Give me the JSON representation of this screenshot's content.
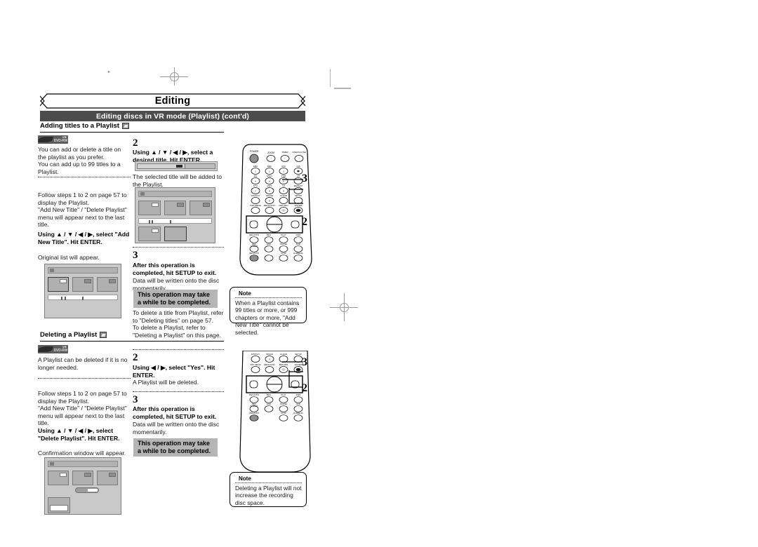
{
  "page": {
    "banner_title": "Editing",
    "sub_banner": "Editing discs in VR mode (Playlist) (cont'd)"
  },
  "section_add": {
    "heading": "Adding titles to a Playlist",
    "badge_icon": "dvd-rw-disc-icon",
    "vr_logo": {
      "top": "VR",
      "bottom": "DVD-RW"
    },
    "intro": "You can add or delete a title on the playlist as you prefer.\nYou can add up to 99 titles to a Playlist.",
    "step1_body": "Follow steps 1 to 2 on page 57 to display the Playlist.\n\"Add New Title\" / \"Delete Playlist\" menu will appear next to the last title.",
    "step1_bold": "Using ▲ / ▼ / ◀ / ▶, select \"Add New Title\". Hit ENTER.",
    "step1_after": "Original list will appear.",
    "step2_num": "2",
    "step2_bold": "Using ▲ / ▼ / ◀ / ▶, select a desired title. Hit ENTER.",
    "step2_after": "The selected title will be added to the Playlist.",
    "step3_num": "3",
    "step3_bold": "After this operation is completed, hit SETUP to exit.",
    "step3_after": "Data will be written onto the disc momentarily.",
    "step3_graybox": "This operation may take a while to be completed.",
    "step3_tail": "To delete a title from Playlist, refer to \"Deleting titles\" on page 57.\nTo delete a Playlist, refer to \"Deleting a Playlist\" on this page.",
    "note": {
      "title": "Note",
      "body": "When a Playlist contains 99 titles or more, or 999 chapters or more, \"Add New Title\" cannot be selected."
    },
    "callouts": {
      "top": "3",
      "bottom": "2"
    }
  },
  "section_delete": {
    "heading": "Deleting a Playlist",
    "badge_icon": "dvd-rw-disc-icon",
    "vr_logo": {
      "top": "VR",
      "bottom": "DVD-RW"
    },
    "intro": "A Playlist can be deleted if it is no longer needed.",
    "step1_body": "Follow steps 1 to 2 on page 57 to display the Playlist.\n\"Add New Title\" / \"Delete Playlist\" menu will appear next to the last title.",
    "step1_bold": "Using ▲ / ▼ / ◀ / ▶, select \"Delete Playlist\". Hit ENTER.",
    "step1_after": "Confirmation window will appear.",
    "step2_num": "2",
    "step2_bold": "Using ◀ / ▶, select \"Yes\". Hit ENTER.",
    "step2_after": "A Playlist will be deleted.",
    "step3_num": "3",
    "step3_bold": "After this operation is completed, hit SETUP to exit.",
    "step3_after": "Data will be written onto the disc momentarily.",
    "step3_graybox": "This operation may take a while to be completed.",
    "note": {
      "title": "Note",
      "body": "Deleting a Playlist will not increase the recording disc space."
    },
    "callouts": {
      "top": "3",
      "bottom": "2"
    }
  },
  "remote": {
    "name": "dvd-recorder-remote-control",
    "rows_top": [
      [
        "POWER",
        "ZOOM",
        "TIMER PROG.",
        "OPEN/CLOSE"
      ],
      [
        "1",
        "2",
        "3",
        "A-B"
      ],
      [
        "4",
        "5",
        "6",
        "CH"
      ],
      [
        "7",
        "8",
        "9",
        "REPEAT"
      ],
      [
        "DISPLAY",
        "0",
        "CLEAR",
        "SETUP"
      ],
      [
        "TOP MENU",
        "MENU/LIST",
        "RETURN",
        "ENTER"
      ]
    ],
    "rows_bottom": [
      [
        "REC/OTR",
        "REV",
        "PLAY",
        "FWD"
      ],
      [
        "REC SPEED",
        "SKIP",
        "PAUSE",
        "SKIP"
      ],
      [
        "REC/OTR",
        "",
        "STOP",
        "DUBBING"
      ]
    ]
  },
  "colors": {
    "banner_bar": "#4c4c4c",
    "gray_box": "#b5b5b5",
    "osd_bg": "#c9c9c9"
  }
}
